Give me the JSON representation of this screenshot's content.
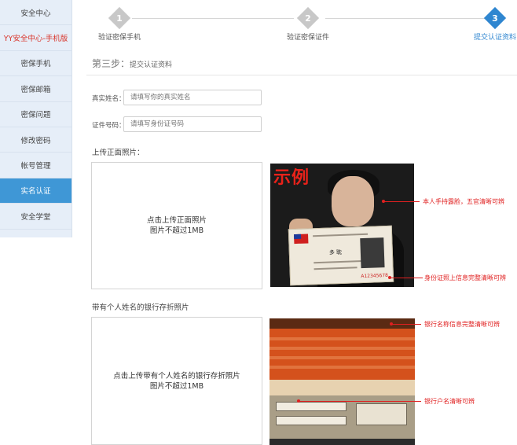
{
  "sidebar": {
    "items": [
      {
        "label": "安全中心"
      },
      {
        "label": "YY安全中心-手机版"
      },
      {
        "label": "密保手机"
      },
      {
        "label": "密保邮箱"
      },
      {
        "label": "密保问题"
      },
      {
        "label": "修改密码"
      },
      {
        "label": "帐号管理"
      },
      {
        "label": "实名认证"
      },
      {
        "label": "安全学堂"
      }
    ],
    "active_index": 7
  },
  "steps": [
    {
      "number": "1",
      "label": "验证密保手机"
    },
    {
      "number": "2",
      "label": "验证密保证件"
    },
    {
      "number": "3",
      "label": "提交认证资料"
    }
  ],
  "current_step": 3,
  "page": {
    "step_prefix": "第三步：",
    "step_title": "提交认证资料"
  },
  "form": {
    "name_label": "真实姓名：",
    "name_placeholder": "请填写你的真实姓名",
    "id_label": "证件号码：",
    "id_placeholder": "请填写身份证号码"
  },
  "upload_front": {
    "section_title": "上传正面照片：",
    "line1": "点击上传正面照片",
    "line2": "图片不超过1MB"
  },
  "upload_bank": {
    "section_title": "带有个人姓名的银行存折照片",
    "line1": "点击上传带有个人姓名的银行存折照片",
    "line2": "图片不超过1MB"
  },
  "example_id": {
    "badge": "示例",
    "card_name": "多 耽",
    "card_number": "A12345678",
    "note_face": "本人手持露脸，五官清晰可辨",
    "note_card": "身份证照上信息完整清晰可辨"
  },
  "example_bank": {
    "note_bank_name": "银行名称信息完整清晰可辨",
    "note_account_name": "银行户名清晰可辨"
  },
  "colors": {
    "accent": "#2f86d0",
    "sidebar_active": "#3f97d6",
    "annotation": "#e02020",
    "red_link": "#d9352b"
  }
}
